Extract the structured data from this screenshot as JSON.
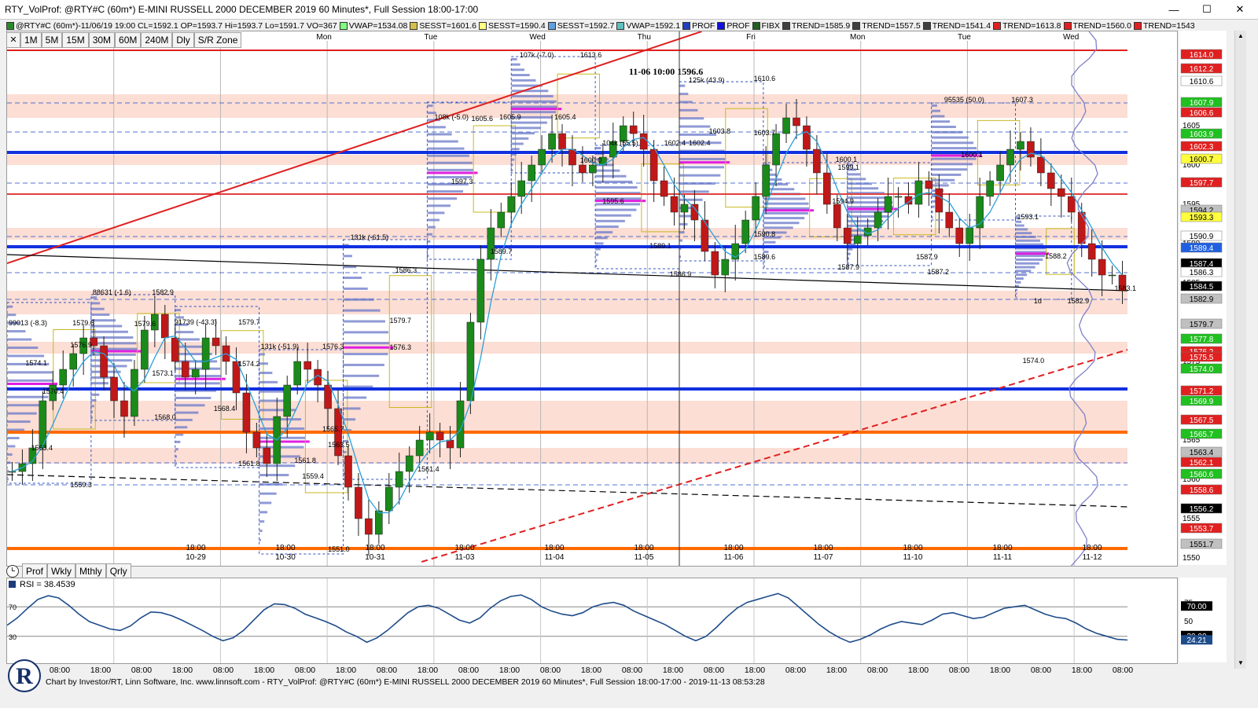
{
  "window": {
    "title": "RTY_VolProf: @RTY#C (60m*) E-MINI RUSSELL 2000 DECEMBER 2019 60 Minutes*, Full Session 18:00-17:00",
    "minimize": "—",
    "maximize": "☐",
    "close": "✕"
  },
  "legend": [
    {
      "text": "@RTY#C (60m*)-11/06/19 19:00 CL=1592.1 OP=1593.7 Hi=1593.7 Lo=1591.7 VO=367",
      "color": "#2a8a2a"
    },
    {
      "text": "VWAP=1534.08",
      "color": "#7fff7f"
    },
    {
      "text": "SESST=1601.6",
      "color": "#d4c04a"
    },
    {
      "text": "SESST=1590.4",
      "color": "#ffff80"
    },
    {
      "text": "SESST=1592.7",
      "color": "#5f9fdf"
    },
    {
      "text": "VWAP=1592.1",
      "color": "#60c0c0"
    },
    {
      "text": "PROF",
      "color": "#2040c0"
    },
    {
      "text": "PROF",
      "color": "#1010e0"
    },
    {
      "text": "FIBX",
      "color": "#206020"
    },
    {
      "text": "TREND=1585.9",
      "color": "#404040"
    },
    {
      "text": "TREND=1557.5",
      "color": "#404040"
    },
    {
      "text": "TREND=1541.4",
      "color": "#404040"
    },
    {
      "text": "TREND=1613.8",
      "color": "#e02020"
    },
    {
      "text": "TREND=1560.0",
      "color": "#e02020"
    },
    {
      "text": "TREND=1543",
      "color": "#e02020"
    }
  ],
  "toolbar": {
    "close": "✕",
    "intervals": [
      "1M",
      "5M",
      "15M",
      "30M",
      "60M",
      "240M",
      "Dly",
      "S/R Zone"
    ]
  },
  "bottom_tabs": {
    "icon": "clock-icon",
    "tabs": [
      "Prof",
      "Wkly",
      "Mthly",
      "Qrly"
    ]
  },
  "chart_data": {
    "type": "candlestick",
    "annotation": "11-06 10:00  1596.6",
    "day_labels": [
      "Thu",
      "Fri",
      "Mon",
      "Tue",
      "Wed",
      "Thu",
      "Fri",
      "Mon",
      "Tue",
      "Wed"
    ],
    "date_labels": [
      "10-29",
      "10-30",
      "10-31",
      "11-03",
      "11-04",
      "11-05",
      "11-06",
      "11-07",
      "11-10",
      "11-11",
      "11-12"
    ],
    "session_time": "18:00",
    "ylim": [
      1549,
      1617
    ],
    "price_ticks": [
      "1605",
      "1600",
      "1595",
      "1590",
      "1585",
      "1580",
      "1575",
      "1570",
      "1565",
      "1560",
      "1555",
      "1550"
    ],
    "close_series": [
      1561,
      1562,
      1564,
      1570,
      1572,
      1574,
      1576,
      1578,
      1577,
      1573,
      1570,
      1568,
      1574,
      1579,
      1581,
      1578,
      1575,
      1573,
      1574,
      1578,
      1577,
      1575,
      1571,
      1566,
      1564,
      1562,
      1568,
      1572,
      1575,
      1574,
      1572,
      1569,
      1563,
      1559,
      1555,
      1553,
      1556,
      1559,
      1561,
      1563,
      1565,
      1566,
      1565,
      1564,
      1570,
      1580,
      1588,
      1592,
      1594,
      1596,
      1598,
      1600,
      1602,
      1604,
      1602,
      1600,
      1599,
      1600,
      1601,
      1603,
      1605,
      1604,
      1602,
      1598,
      1596,
      1594,
      1595,
      1593,
      1589,
      1586,
      1588,
      1590,
      1593,
      1596,
      1600,
      1604,
      1606,
      1605,
      1602,
      1599,
      1595,
      1592,
      1590,
      1591,
      1592,
      1594,
      1596,
      1596,
      1595,
      1598,
      1597,
      1594,
      1592,
      1590,
      1592,
      1596,
      1598,
      1600,
      1602,
      1603,
      1601,
      1599,
      1597,
      1596,
      1594,
      1590,
      1588,
      1586,
      1586,
      1584
    ],
    "price_labels": [
      {
        "price": 1614.0,
        "text": "1614.0",
        "bg": "#e02020",
        "fg": "#ffffff"
      },
      {
        "price": 1612.2,
        "text": "1612.2",
        "bg": "#e02020",
        "fg": "#ffffff"
      },
      {
        "price": 1610.6,
        "text": "1610.6",
        "bg": "#ffffff",
        "fg": "#000000"
      },
      {
        "price": 1607.9,
        "text": "1607.9",
        "bg": "#20c020",
        "fg": "#ffffff"
      },
      {
        "price": 1606.6,
        "text": "1606.6",
        "bg": "#e02020",
        "fg": "#ffffff"
      },
      {
        "price": 1603.9,
        "text": "1603.9",
        "bg": "#20c020",
        "fg": "#ffffff"
      },
      {
        "price": 1602.3,
        "text": "1602.3",
        "bg": "#e02020",
        "fg": "#ffffff"
      },
      {
        "price": 1600.7,
        "text": "1600.7",
        "bg": "#ffff40",
        "fg": "#000000"
      },
      {
        "price": 1597.7,
        "text": "1597.7",
        "bg": "#e02020",
        "fg": "#ffffff"
      },
      {
        "price": 1594.2,
        "text": "1594.2",
        "bg": "#c0c0c0",
        "fg": "#000000"
      },
      {
        "price": 1593.3,
        "text": "1593.3",
        "bg": "#ffff40",
        "fg": "#000000"
      },
      {
        "price": 1590.9,
        "text": "1590.9",
        "bg": "#ffffff",
        "fg": "#000000"
      },
      {
        "price": 1589.4,
        "text": "1589.4",
        "bg": "#2060e0",
        "fg": "#ffffff"
      },
      {
        "price": 1587.4,
        "text": "1587.4",
        "bg": "#000000",
        "fg": "#ffffff"
      },
      {
        "price": 1586.3,
        "text": "1586.3",
        "bg": "#ffffff",
        "fg": "#000000"
      },
      {
        "price": 1584.5,
        "text": "1584.5",
        "bg": "#000000",
        "fg": "#ffffff"
      },
      {
        "price": 1582.9,
        "text": "1582.9",
        "bg": "#c0c0c0",
        "fg": "#000000"
      },
      {
        "price": 1579.7,
        "text": "1579.7",
        "bg": "#c0c0c0",
        "fg": "#000000"
      },
      {
        "price": 1577.8,
        "text": "1577.8",
        "bg": "#20c020",
        "fg": "#ffffff"
      },
      {
        "price": 1576.2,
        "text": "1576.2",
        "bg": "#e02020",
        "fg": "#ffffff"
      },
      {
        "price": 1575.5,
        "text": "1575.5",
        "bg": "#e02020",
        "fg": "#ffffff"
      },
      {
        "price": 1574.0,
        "text": "1574.0",
        "bg": "#20c020",
        "fg": "#ffffff"
      },
      {
        "price": 1571.2,
        "text": "1571.2",
        "bg": "#e02020",
        "fg": "#ffffff"
      },
      {
        "price": 1569.9,
        "text": "1569.9",
        "bg": "#20c020",
        "fg": "#ffffff"
      },
      {
        "price": 1567.5,
        "text": "1567.5",
        "bg": "#e02020",
        "fg": "#ffffff"
      },
      {
        "price": 1565.7,
        "text": "1565.7",
        "bg": "#20c020",
        "fg": "#ffffff"
      },
      {
        "price": 1563.4,
        "text": "1563.4",
        "bg": "#c0c0c0",
        "fg": "#000000"
      },
      {
        "price": 1562.1,
        "text": "1562.1",
        "bg": "#e02020",
        "fg": "#ffffff"
      },
      {
        "price": 1560.6,
        "text": "1560.6",
        "bg": "#20c020",
        "fg": "#ffffff"
      },
      {
        "price": 1558.6,
        "text": "1558.6",
        "bg": "#e02020",
        "fg": "#ffffff"
      },
      {
        "price": 1556.2,
        "text": "1556.2",
        "bg": "#000000",
        "fg": "#ffffff"
      },
      {
        "price": 1553.7,
        "text": "1553.7",
        "bg": "#e02020",
        "fg": "#ffffff"
      },
      {
        "price": 1551.7,
        "text": "1551.7",
        "bg": "#c0c0c0",
        "fg": "#000000"
      }
    ],
    "zones": [
      {
        "from": 1606.0,
        "to": 1609.0
      },
      {
        "from": 1600.0,
        "to": 1601.3
      },
      {
        "from": 1590.5,
        "to": 1592.0
      },
      {
        "from": 1581.0,
        "to": 1584.0
      },
      {
        "from": 1576.0,
        "to": 1577.5
      },
      {
        "from": 1566.0,
        "to": 1570.0
      },
      {
        "from": 1562.0,
        "to": 1564.0
      }
    ],
    "hlines": [
      {
        "price": 1601.6,
        "color": "#1030e0",
        "width": 4
      },
      {
        "price": 1589.6,
        "color": "#1030e0",
        "width": 4
      },
      {
        "price": 1571.5,
        "color": "#1030e0",
        "width": 4
      },
      {
        "price": 1596.3,
        "color": "#e04040",
        "width": 2
      },
      {
        "price": 1566.0,
        "color": "#ff6a00",
        "width": 4
      },
      {
        "price": 1551.2,
        "color": "#ff6a00",
        "width": 4
      },
      {
        "price": 1614.6,
        "color": "#e02020",
        "width": 2
      }
    ],
    "trendlines": [
      {
        "name": "TREND=1613.8",
        "from": [
          0,
          1587.5
        ],
        "to": [
          0.62,
          1617.0
        ],
        "color": "#e02020",
        "dash": false
      },
      {
        "name": "TREND=1560.0",
        "from": [
          0.37,
          1549.5
        ],
        "to": [
          1.0,
          1576.5
        ],
        "color": "#e02020",
        "dash": true
      },
      {
        "name": "TREND=1585.9",
        "from": [
          0,
          1588.6
        ],
        "to": [
          1.0,
          1584.0
        ],
        "color": "#000000",
        "dash": false
      },
      {
        "name": "TREND=1557.5",
        "from": [
          0,
          1560.6
        ],
        "to": [
          1.0,
          1556.5
        ],
        "color": "#000000",
        "dash": true
      }
    ],
    "profile_labels": [
      {
        "text": "99013 (-8.3)",
        "x": 0.0,
        "p": 1579.5
      },
      {
        "text": "1579.6",
        "x": 0.057,
        "p": 1579.5
      },
      {
        "text": "1576.9",
        "x": 0.055,
        "p": 1576.7
      },
      {
        "text": "1574.1",
        "x": 0.015,
        "p": 1574.4
      },
      {
        "text": "1570.4",
        "x": 0.03,
        "p": 1570.8
      },
      {
        "text": "1563.4",
        "x": 0.02,
        "p": 1563.6
      },
      {
        "text": "1559.3",
        "x": 0.055,
        "p": 1558.9
      },
      {
        "text": "88631 (-1.6)",
        "x": 0.075,
        "p": 1583.4
      },
      {
        "text": "1582.9",
        "x": 0.128,
        "p": 1583.4
      },
      {
        "text": "1579.6",
        "x": 0.112,
        "p": 1579.4
      },
      {
        "text": "1573.1",
        "x": 0.128,
        "p": 1573.1
      },
      {
        "text": "1568.0",
        "x": 0.13,
        "p": 1567.5
      },
      {
        "text": "91739 (-43.3)",
        "x": 0.148,
        "p": 1579.6
      },
      {
        "text": "1579.7",
        "x": 0.205,
        "p": 1579.6
      },
      {
        "text": "1574.2",
        "x": 0.205,
        "p": 1574.3
      },
      {
        "text": "1568.4",
        "x": 0.183,
        "p": 1568.6
      },
      {
        "text": "1561.8",
        "x": 0.205,
        "p": 1561.6
      },
      {
        "text": "131k (-51.9)",
        "x": 0.225,
        "p": 1576.5
      },
      {
        "text": "1576.3",
        "x": 0.28,
        "p": 1576.5
      },
      {
        "text": "1565.7",
        "x": 0.28,
        "p": 1566.0
      },
      {
        "text": "1563.5",
        "x": 0.285,
        "p": 1564.0
      },
      {
        "text": "1561.8",
        "x": 0.255,
        "p": 1562.0
      },
      {
        "text": "1559.4",
        "x": 0.262,
        "p": 1560.0
      },
      {
        "text": "1551.0",
        "x": 0.285,
        "p": 1550.7
      },
      {
        "text": "131k (-61.5)",
        "x": 0.305,
        "p": 1590.4
      },
      {
        "text": "1586.3",
        "x": 0.345,
        "p": 1586.2
      },
      {
        "text": "1579.7",
        "x": 0.34,
        "p": 1579.8
      },
      {
        "text": "1576.3",
        "x": 0.34,
        "p": 1576.4
      },
      {
        "text": "1561.4",
        "x": 0.365,
        "p": 1560.9
      },
      {
        "text": "108k (-5.0)",
        "x": 0.38,
        "p": 1605.7
      },
      {
        "text": "1605.6",
        "x": 0.413,
        "p": 1605.5
      },
      {
        "text": "1597.3",
        "x": 0.395,
        "p": 1597.5
      },
      {
        "text": "1589.7",
        "x": 0.43,
        "p": 1588.6
      },
      {
        "text": "107k (-7.0)",
        "x": 0.456,
        "p": 1613.6
      },
      {
        "text": "1605.9",
        "x": 0.438,
        "p": 1605.7
      },
      {
        "text": "1605.4",
        "x": 0.487,
        "p": 1605.7
      },
      {
        "text": "1600.0",
        "x": 0.51,
        "p": 1600.2
      },
      {
        "text": "1613.6",
        "x": 0.51,
        "p": 1613.6
      },
      {
        "text": "104k (55.5)",
        "x": 0.53,
        "p": 1602.4
      },
      {
        "text": "1602.4",
        "x": 0.585,
        "p": 1602.4
      },
      {
        "text": "1595.6",
        "x": 0.53,
        "p": 1595.0
      },
      {
        "text": "1589.1",
        "x": 0.572,
        "p": 1589.3
      },
      {
        "text": "1586.9",
        "x": 0.59,
        "p": 1585.7
      },
      {
        "text": "125k (43.9)",
        "x": 0.607,
        "p": 1610.4
      },
      {
        "text": "1610.6",
        "x": 0.665,
        "p": 1610.6
      },
      {
        "text": "1603.8",
        "x": 0.625,
        "p": 1603.9
      },
      {
        "text": "1603.7",
        "x": 0.665,
        "p": 1603.7
      },
      {
        "text": "1602.4",
        "x": 0.607,
        "p": 1602.4
      },
      {
        "text": "1590.8",
        "x": 0.665,
        "p": 1590.8
      },
      {
        "text": "1589.6",
        "x": 0.665,
        "p": 1587.9
      },
      {
        "text": "1600.1",
        "x": 0.738,
        "p": 1600.3
      },
      {
        "text": "1599.1",
        "x": 0.74,
        "p": 1599.3
      },
      {
        "text": "1594.9",
        "x": 0.735,
        "p": 1595.0
      },
      {
        "text": "1587.9",
        "x": 0.74,
        "p": 1586.6
      },
      {
        "text": "1587.9",
        "x": 0.81,
        "p": 1587.9
      },
      {
        "text": "1587.2",
        "x": 0.82,
        "p": 1586.0
      },
      {
        "text": "95535 (50.0)",
        "x": 0.835,
        "p": 1607.9
      },
      {
        "text": "1607.3",
        "x": 0.895,
        "p": 1607.9
      },
      {
        "text": "1600.1",
        "x": 0.85,
        "p": 1600.9
      },
      {
        "text": "1593.1",
        "x": 0.9,
        "p": 1593.0
      },
      {
        "text": "1588.2",
        "x": 0.925,
        "p": 1588.0
      },
      {
        "text": "1583.1",
        "x": 0.987,
        "p": 1583.9
      },
      {
        "text": "1582.9",
        "x": 0.945,
        "p": 1582.3
      },
      {
        "text": "1d",
        "x": 0.915,
        "p": 1582.3
      },
      {
        "text": "1574.0",
        "x": 0.905,
        "p": 1574.7
      }
    ],
    "profiles": [
      {
        "x": 0.0,
        "w": 0.075,
        "top": 1582.5,
        "bot": 1559.5
      },
      {
        "x": 0.075,
        "w": 0.075,
        "top": 1583.5,
        "bot": 1567.5
      },
      {
        "x": 0.15,
        "w": 0.075,
        "top": 1582.0,
        "bot": 1561.5
      },
      {
        "x": 0.225,
        "w": 0.075,
        "top": 1576.5,
        "bot": 1550.5
      },
      {
        "x": 0.3,
        "w": 0.075,
        "top": 1590.5,
        "bot": 1560.0
      },
      {
        "x": 0.375,
        "w": 0.075,
        "top": 1608.0,
        "bot": 1588.0
      },
      {
        "x": 0.45,
        "w": 0.075,
        "top": 1613.8,
        "bot": 1599.0
      },
      {
        "x": 0.525,
        "w": 0.075,
        "top": 1602.5,
        "bot": 1586.8
      },
      {
        "x": 0.6,
        "w": 0.075,
        "top": 1610.6,
        "bot": 1587.8
      },
      {
        "x": 0.675,
        "w": 0.075,
        "top": 1600.3,
        "bot": 1586.8
      },
      {
        "x": 0.75,
        "w": 0.075,
        "top": 1600.3,
        "bot": 1587.2
      },
      {
        "x": 0.825,
        "w": 0.075,
        "top": 1607.9,
        "bot": 1593.0
      },
      {
        "x": 0.9,
        "w": 0.05,
        "top": 1593.5,
        "bot": 1582.9
      }
    ]
  },
  "rsi": {
    "title": "RSI = 38.4539",
    "ylim": [
      0,
      100
    ],
    "levels": [
      70,
      30
    ],
    "ticks": [
      "75",
      "70",
      "50",
      "25",
      "30"
    ],
    "left_marks": [
      "70",
      "30"
    ],
    "tags": [
      {
        "v": 70,
        "text": "70.00"
      },
      {
        "v": 30,
        "text": "30.00"
      },
      {
        "v": 24.21,
        "text": "24.21"
      }
    ],
    "values": [
      45,
      55,
      68,
      80,
      85,
      82,
      72,
      60,
      50,
      45,
      40,
      38,
      44,
      55,
      63,
      62,
      58,
      52,
      45,
      38,
      30,
      24,
      28,
      38,
      52,
      66,
      74,
      73,
      68,
      60,
      55,
      50,
      44,
      36,
      30,
      22,
      28,
      38,
      50,
      62,
      70,
      72,
      68,
      60,
      52,
      48,
      55,
      68,
      78,
      84,
      86,
      80,
      70,
      64,
      60,
      58,
      62,
      70,
      74,
      76,
      72,
      64,
      58,
      52,
      46,
      38,
      30,
      24,
      30,
      42,
      56,
      68,
      76,
      80,
      84,
      88,
      82,
      70,
      58,
      46,
      36,
      28,
      22,
      26,
      32,
      40,
      46,
      50,
      48,
      46,
      52,
      60,
      62,
      58,
      54,
      56,
      62,
      68,
      70,
      72,
      66,
      60,
      56,
      54,
      48,
      40,
      34,
      30,
      26,
      25
    ]
  },
  "time_axis": {
    "labels": [
      "08:00",
      "18:00",
      "08:00",
      "18:00",
      "08:00",
      "18:00",
      "08:00",
      "18:00",
      "08:00",
      "18:00",
      "08:00",
      "18:00",
      "08:00",
      "18:00",
      "08:00",
      "18:00",
      "08:00",
      "18:00",
      "08:00",
      "18:00",
      "08:00",
      "18:00",
      "08:00",
      "18:00",
      "08:00",
      "18:00",
      "08:00"
    ]
  },
  "footer": "Chart by Investor/RT, Linn Software, Inc. www.linnsoft.com - RTY_VolProf: @RTY#C (60m*) E-MINI RUSSELL 2000 DECEMBER 2019 60 Minutes*, Full Session 18:00-17:00 - 2019-11-13 08:53:28",
  "logo_text": "R"
}
